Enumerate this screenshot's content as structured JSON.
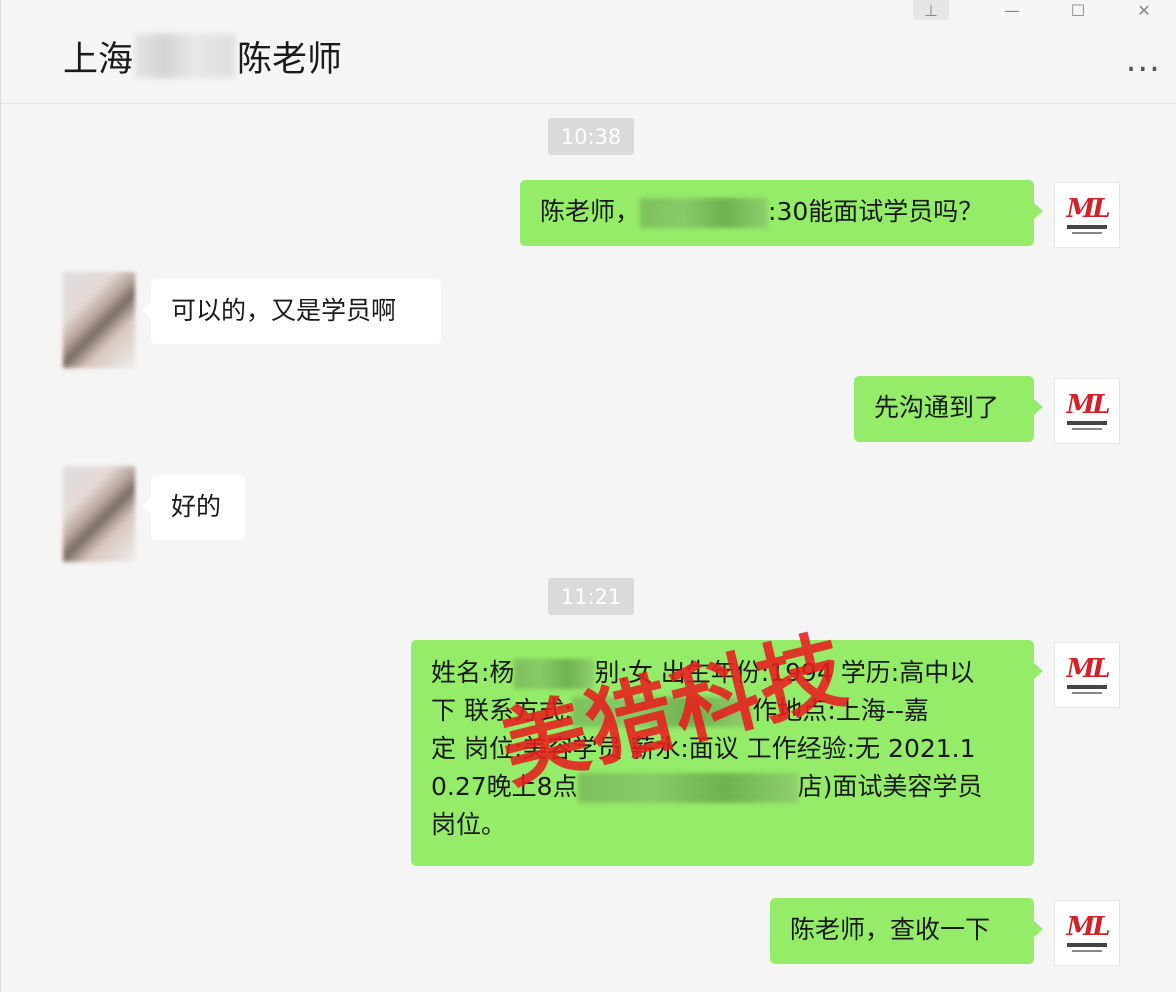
{
  "header": {
    "title_prefix": "上海",
    "title_suffix": "陈老师",
    "more_label": "..."
  },
  "window_controls": {
    "pin": "⊥",
    "minimize": "—",
    "maximize": "☐",
    "close": "✕"
  },
  "avatars": {
    "self_logo_text": "ML"
  },
  "messages": [
    {
      "type": "time",
      "text": "10:38"
    },
    {
      "type": "out",
      "pre": "陈老师，",
      "post": ":30能面试学员吗？"
    },
    {
      "type": "in",
      "text": "可以的，又是学员啊"
    },
    {
      "type": "out",
      "text": "先沟通到了"
    },
    {
      "type": "in",
      "text": "好的"
    },
    {
      "type": "time",
      "text": "11:21"
    },
    {
      "type": "out",
      "lines": [
        "姓名:杨",
        "别:女 出生年份:1994 学历:高中以",
        "下 联系方式:",
        "作地点:上海--嘉",
        "定 岗位:美容学员 薪水:面议 工作经验:无 2021.1",
        "0.27晚上8点",
        "店)面试美容学员",
        "岗位。"
      ]
    },
    {
      "type": "out",
      "text": "陈老师，查收一下"
    }
  ],
  "watermark": "美猎科技"
}
